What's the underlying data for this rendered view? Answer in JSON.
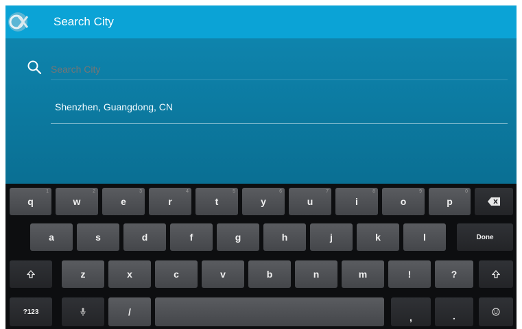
{
  "action_bar": {
    "title": "Search City",
    "app_icon": "weather-app-icon"
  },
  "search": {
    "placeholder": "Search City",
    "value": "",
    "icon": "search-icon"
  },
  "results": [
    {
      "label": "Shenzhen, Guangdong, CN"
    }
  ],
  "keyboard": {
    "row1": [
      {
        "label": "q",
        "hint": "1"
      },
      {
        "label": "w",
        "hint": "2"
      },
      {
        "label": "e",
        "hint": "3"
      },
      {
        "label": "r",
        "hint": "4"
      },
      {
        "label": "t",
        "hint": "5"
      },
      {
        "label": "y",
        "hint": "6"
      },
      {
        "label": "u",
        "hint": "7"
      },
      {
        "label": "i",
        "hint": "8"
      },
      {
        "label": "o",
        "hint": "9"
      },
      {
        "label": "p",
        "hint": "0"
      }
    ],
    "row2": [
      "a",
      "s",
      "d",
      "f",
      "g",
      "h",
      "j",
      "k",
      "l"
    ],
    "done_label": "Done",
    "row3": [
      "z",
      "x",
      "c",
      "v",
      "b",
      "n",
      "m",
      "!",
      "?"
    ],
    "symbols_label": "?123",
    "slash_label": "/",
    "comma_label": ",",
    "period_label": ".",
    "icons": {
      "backspace": "backspace-icon",
      "shift": "shift-icon",
      "microphone": "microphone-icon",
      "emoji": "emoji-icon"
    }
  },
  "colors": {
    "action_bar": "#0ba3d6",
    "content": "#0e7ba0",
    "keyboard": "#0d0e10",
    "key": "#505256"
  }
}
